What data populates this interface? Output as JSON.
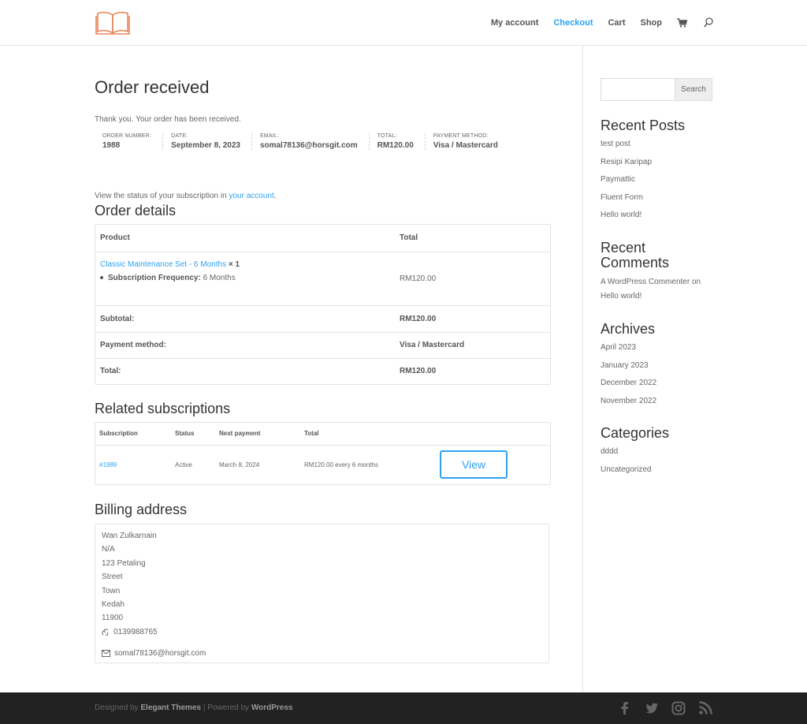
{
  "nav": {
    "items": [
      {
        "label": "My account"
      },
      {
        "label": "Checkout"
      },
      {
        "label": "Cart"
      },
      {
        "label": "Shop"
      }
    ]
  },
  "page": {
    "title": "Order received",
    "thanks": "Thank you. Your order has been received.",
    "overview": [
      {
        "label": "ORDER NUMBER:",
        "value": "1988"
      },
      {
        "label": "DATE:",
        "value": "September 8, 2023"
      },
      {
        "label": "EMAIL:",
        "value": "somal78136@horsgit.com"
      },
      {
        "label": "TOTAL:",
        "value": "RM120.00"
      },
      {
        "label": "PAYMENT METHOD:",
        "value": "Visa / Mastercard"
      }
    ],
    "subscription_note_prefix": "View the status of your subscription in ",
    "subscription_note_link": "your account",
    "subscription_note_suffix": "."
  },
  "order_details": {
    "heading": "Order details",
    "col_product": "Product",
    "col_total": "Total",
    "product_name": "Classic Maintenance Set - 6 Months",
    "product_qty": "× 1",
    "meta_key": "Subscription Frequency:",
    "meta_value": "6 Months",
    "product_total": "RM120.00",
    "subtotal_label": "Subtotal:",
    "subtotal_value": "RM120.00",
    "payment_label": "Payment method:",
    "payment_value": "Visa / Mastercard",
    "total_label": "Total:",
    "total_value": "RM120.00"
  },
  "related": {
    "heading": "Related subscriptions",
    "columns": [
      "Subscription",
      "Status",
      "Next payment",
      "Total"
    ],
    "row": {
      "id": "#1989",
      "status": "Active",
      "next_payment": "March 8, 2024",
      "total": "RM120.00 every 6 months",
      "action": "View"
    }
  },
  "billing": {
    "heading": "Billing address",
    "lines": [
      "Wan Zulkarnain",
      "N/A",
      "123 Petaling",
      "Street",
      "Town",
      "Kedah",
      "11900"
    ],
    "phone": "0139988765",
    "email": "somal78136@horsgit.com"
  },
  "sidebar": {
    "search_button": "Search",
    "recent_posts": {
      "heading": "Recent Posts",
      "items": [
        "test post",
        "Resipi Karipap",
        "Paymattic",
        "Fluent Form",
        "Hello world!"
      ]
    },
    "recent_comments": {
      "heading_line1": "Recent",
      "heading_line2": "Comments",
      "author": "A WordPress Commenter",
      "on": " on ",
      "post": "Hello world!"
    },
    "archives": {
      "heading": "Archives",
      "items": [
        "April 2023",
        "January 2023",
        "December 2022",
        "November 2022"
      ]
    },
    "categories": {
      "heading": "Categories",
      "items": [
        "dddd",
        "Uncategorized"
      ]
    }
  },
  "footer": {
    "designed_by": "Designed by ",
    "elegant": "Elegant Themes",
    "sep": " | Powered by ",
    "wordpress": "WordPress"
  },
  "colors": {
    "accent": "#2ea3f2",
    "logo": "#e8865b",
    "footer_bg": "#222222"
  }
}
